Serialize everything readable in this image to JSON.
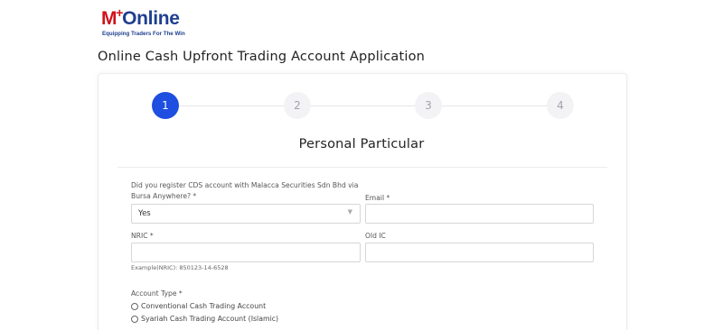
{
  "logo": {
    "brand_m": "M",
    "brand_plus": "+",
    "brand_online": "Online",
    "tagline": "Equipping Traders For The Win"
  },
  "page_title": "Online Cash Upfront Trading Account Application",
  "stepper": {
    "steps": [
      "1",
      "2",
      "3",
      "4"
    ],
    "active_step": 1
  },
  "section_title": "Personal Particular",
  "form": {
    "cds_question_line1": "Did you register CDS account with Malacca Securities Sdn Bhd via",
    "cds_question_line2": "Bursa Anywhere? *",
    "cds_value": "Yes",
    "email_label": "Email *",
    "email_value": "",
    "nric_label": "NRIC *",
    "nric_value": "",
    "nric_hint": "Example(NRIC): 850123-14-6528",
    "old_ic_label": "Old IC",
    "old_ic_value": "",
    "account_type_label": "Account Type *",
    "account_type_options": [
      "Conventional Cash Trading Account",
      "Syariah Cash Trading Account (Islamic)"
    ]
  },
  "colors": {
    "accent": "#1e4fe0",
    "brand_red": "#d0111b",
    "brand_blue": "#1f3f8f"
  }
}
